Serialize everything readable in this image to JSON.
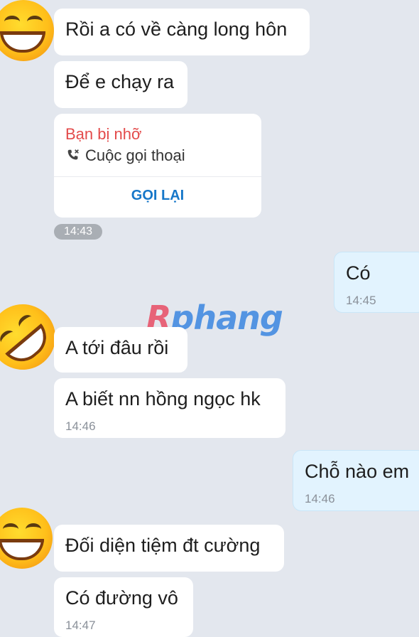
{
  "messages": {
    "m1": {
      "text": "Rồi a có về càng long hôn"
    },
    "m2": {
      "text": "Để e chạy ra"
    },
    "missed_call": {
      "title": "Bạn bị nhỡ",
      "subtitle": "Cuộc gọi thoại",
      "action": "GỌI LẠI",
      "time": "14:43"
    },
    "m4": {
      "text": "Có",
      "time": "14:45"
    },
    "m5": {
      "text": "A tới đâu rồi"
    },
    "m6": {
      "text": "A biết nn hồng ngọc hk",
      "time": "14:46"
    },
    "m7": {
      "text": "Chỗ nào em",
      "time": "14:46"
    },
    "m8": {
      "text": "Đối diện tiệm đt cường"
    },
    "m9": {
      "text": "Có đường vô",
      "time": "14:47"
    }
  },
  "watermark": {
    "first": "R",
    "rest": "phang"
  },
  "colors": {
    "background": "#e3e7ee",
    "incoming": "#ffffff",
    "outgoing": "#e2f3fe",
    "missed": "#e34b4b",
    "link": "#1677c9"
  },
  "icons": [
    "grinning-emoji",
    "laughing-emoji",
    "missed-call-icon"
  ]
}
